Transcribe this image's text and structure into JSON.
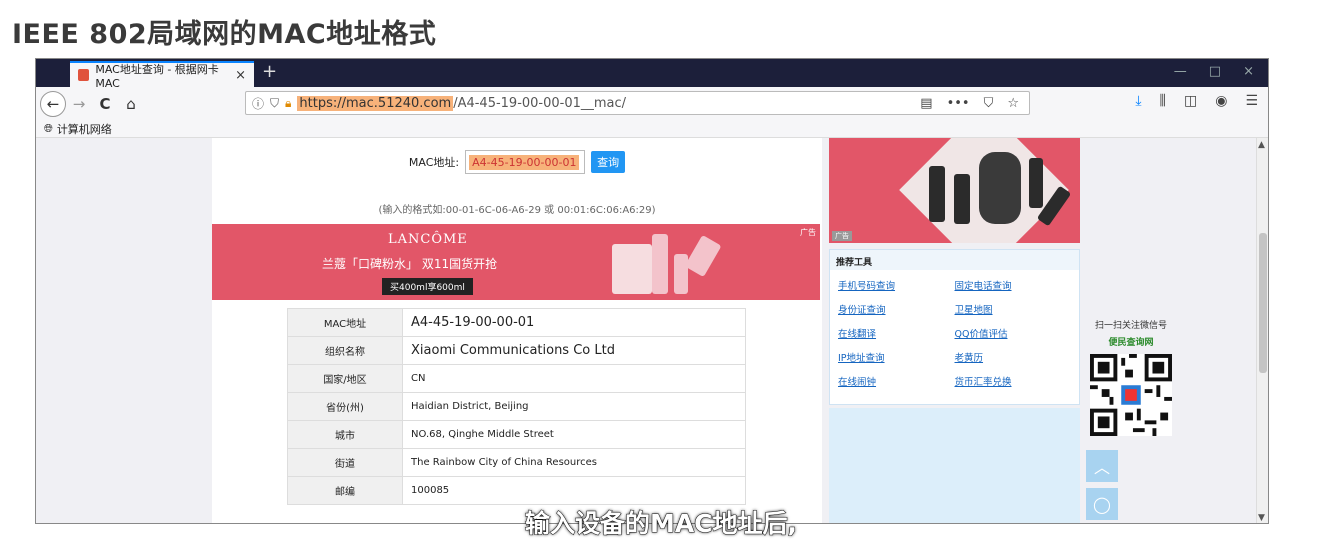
{
  "slide": {
    "title": "IEEE 802局域网的MAC地址格式",
    "subtitle": "输入设备的MAC地址后,"
  },
  "browser": {
    "tab_title": "MAC地址查询 - 根据网卡MAC",
    "tab_close": "×",
    "new_tab": "+",
    "window_controls": [
      "—",
      "□",
      "×"
    ],
    "url_highlight": "https://mac.51240.com",
    "url_rest": "/A4-45-19-00-00-01__mac/",
    "bookmark": "计算机网络",
    "icons": {
      "back": "←",
      "forward": "→",
      "reload": "C",
      "home": "⌂",
      "more": "•••"
    }
  },
  "page": {
    "query_label": "MAC地址:",
    "query_value": "A4-45-19-00-00-01",
    "query_button": "查询",
    "hint": "(输入的格式如:00-01-6C-06-A6-29 或 00:01:6C:06:A6:29)",
    "ad": {
      "brand": "LANCÔME",
      "slogan": "兰蔻「口碑粉水」 双11国货开抢",
      "promo": "买400ml享600ml",
      "tag": "广告"
    },
    "rows": [
      {
        "key": "MAC地址",
        "value": "A4-45-19-00-00-01"
      },
      {
        "key": "组织名称",
        "value": "Xiaomi Communications Co Ltd"
      },
      {
        "key": "国家/地区",
        "value": "CN"
      },
      {
        "key": "省份(州)",
        "value": "Haidian District, Beijing"
      },
      {
        "key": "城市",
        "value": "NO.68, Qinghe Middle Street"
      },
      {
        "key": "街道",
        "value": "The Rainbow City of China Resources"
      },
      {
        "key": "邮编",
        "value": "100085"
      }
    ]
  },
  "sidebar": {
    "ad_tag": "广告",
    "tools_title": "推荐工具",
    "tools": [
      "手机号码查询",
      "固定电话查询",
      "身份证查询",
      "卫星地图",
      "在线翻译",
      "QQ价值评估",
      "IP地址查询",
      "老黄历",
      "在线闹钟",
      "货币汇率兑换"
    ],
    "qr_text": "扫一扫关注微信号",
    "qr_name": "便民查询网"
  }
}
